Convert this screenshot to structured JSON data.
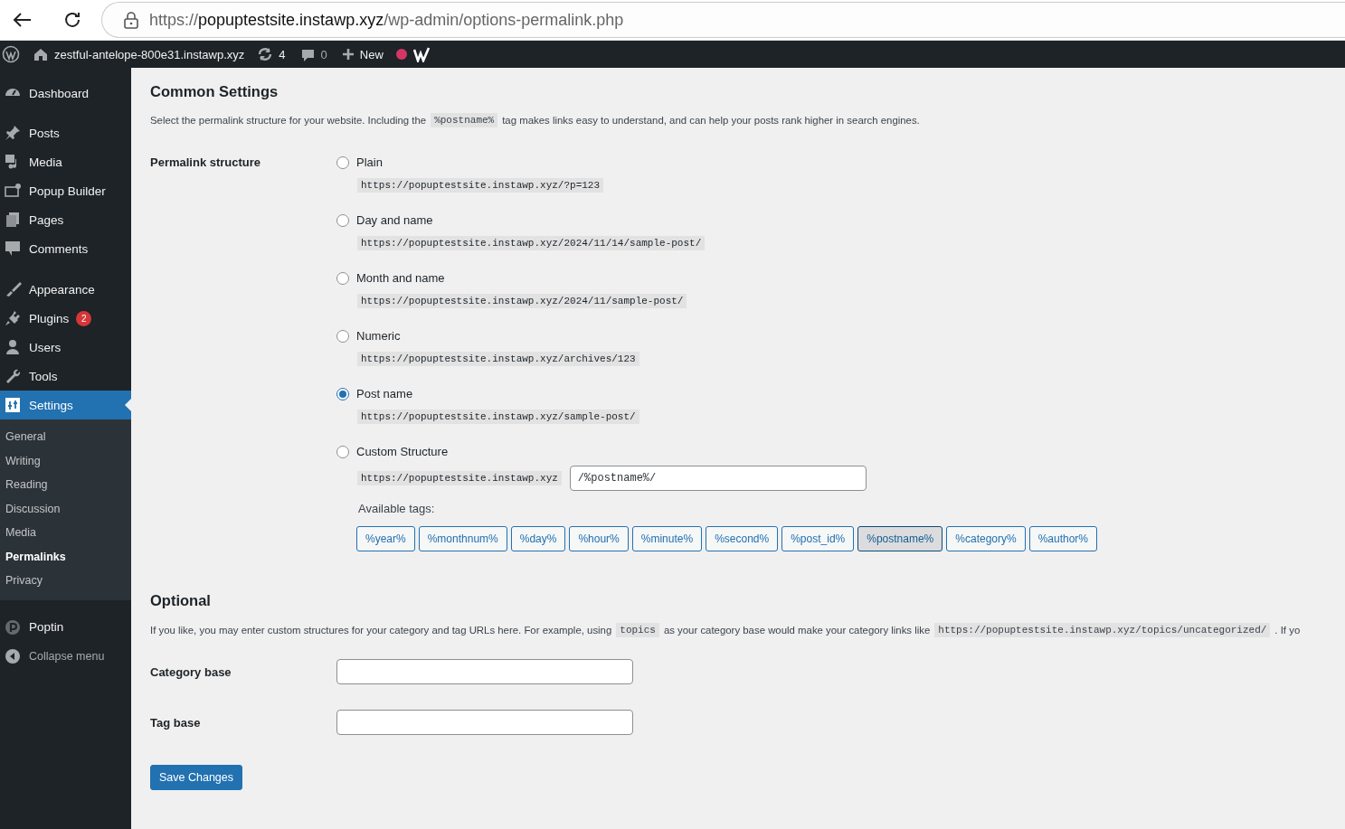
{
  "browser": {
    "url_scheme": "https://",
    "url_host": "popuptestsite.instawp.xyz",
    "url_path": "/wp-admin/options-permalink.php"
  },
  "admin_bar": {
    "site": "zestful-antelope-800e31.instawp.xyz",
    "updates": "4",
    "comments": "0",
    "new": "New"
  },
  "sidebar": {
    "items": [
      {
        "label": "Dashboard",
        "selected": false
      },
      {
        "label": "Posts",
        "selected": false
      },
      {
        "label": "Media",
        "selected": false
      },
      {
        "label": "Popup Builder",
        "selected": false
      },
      {
        "label": "Pages",
        "selected": false
      },
      {
        "label": "Comments",
        "selected": false
      },
      {
        "label": "Appearance",
        "selected": false
      },
      {
        "label": "Plugins",
        "badge": "2",
        "selected": false
      },
      {
        "label": "Users",
        "selected": false
      },
      {
        "label": "Tools",
        "selected": false
      },
      {
        "label": "Settings",
        "selected": true,
        "children": [
          {
            "label": "General",
            "selected": false
          },
          {
            "label": "Writing",
            "selected": false
          },
          {
            "label": "Reading",
            "selected": false
          },
          {
            "label": "Discussion",
            "selected": false
          },
          {
            "label": "Media",
            "selected": false
          },
          {
            "label": "Permalinks",
            "selected": true
          },
          {
            "label": "Privacy",
            "selected": false
          }
        ]
      },
      {
        "label": "Poptin",
        "selected": false
      },
      {
        "label": "Collapse menu",
        "selected": false
      }
    ]
  },
  "common": {
    "title": "Common Settings",
    "description": [
      {
        "kind": "text",
        "text": "Select the permalink structure for your website. Including the"
      },
      {
        "kind": "code",
        "text": "%postname%"
      },
      {
        "kind": "text",
        "text": "tag makes links easy to understand, and can help your posts rank higher in search engines."
      }
    ],
    "structure_label": "Permalink structure",
    "options": [
      {
        "kind": "preset",
        "label": "Plain",
        "example": "https://popuptestsite.instawp.xyz/?p=123",
        "selected": false
      },
      {
        "kind": "preset",
        "label": "Day and name",
        "example": "https://popuptestsite.instawp.xyz/2024/11/14/sample-post/",
        "selected": false
      },
      {
        "kind": "preset",
        "label": "Month and name",
        "example": "https://popuptestsite.instawp.xyz/2024/11/sample-post/",
        "selected": false
      },
      {
        "kind": "preset",
        "label": "Numeric",
        "example": "https://popuptestsite.instawp.xyz/archives/123",
        "selected": false
      },
      {
        "kind": "preset",
        "label": "Post name",
        "example": "https://popuptestsite.instawp.xyz/sample-post/",
        "selected": true
      },
      {
        "kind": "custom",
        "label": "Custom Structure",
        "example": "https://popuptestsite.instawp.xyz",
        "value": "/%postname%/",
        "selected": false
      }
    ],
    "tags_label": "Available tags:",
    "tags": [
      {
        "label": "%year%",
        "selected": false
      },
      {
        "label": "%monthnum%",
        "selected": false
      },
      {
        "label": "%day%",
        "selected": false
      },
      {
        "label": "%hour%",
        "selected": false
      },
      {
        "label": "%minute%",
        "selected": false
      },
      {
        "label": "%second%",
        "selected": false
      },
      {
        "label": "%post_id%",
        "selected": false
      },
      {
        "label": "%postname%",
        "selected": true
      },
      {
        "label": "%category%",
        "selected": false
      },
      {
        "label": "%author%",
        "selected": false
      }
    ]
  },
  "optional": {
    "title": "Optional",
    "description": [
      {
        "kind": "text",
        "text": "If you like, you may enter custom structures for your category and tag URLs here. For example, using"
      },
      {
        "kind": "code",
        "text": "topics"
      },
      {
        "kind": "text",
        "text": "as your category base would make your category links like"
      },
      {
        "kind": "code",
        "text": "https://popuptestsite.instawp.xyz/topics/uncategorized/"
      },
      {
        "kind": "text",
        "text": ". If yo"
      }
    ],
    "fields": [
      {
        "label": "Category base"
      },
      {
        "label": "Tag base"
      }
    ]
  },
  "save_button": "Save Changes"
}
